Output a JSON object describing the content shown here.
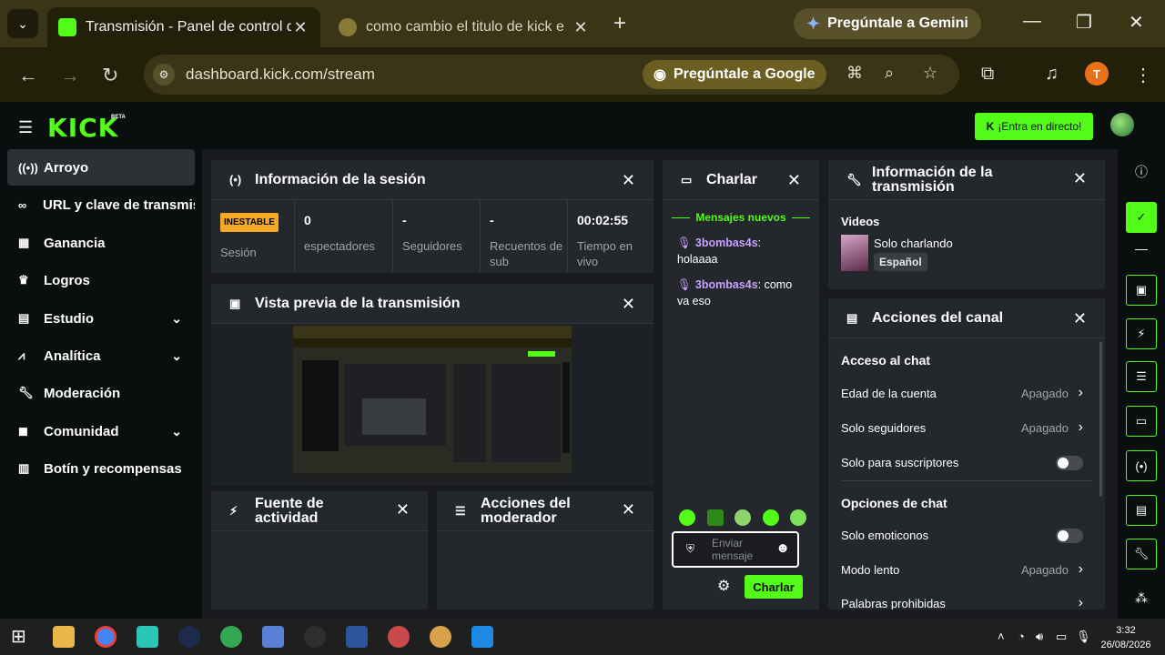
{
  "browser": {
    "tabs": [
      {
        "title": "Transmisión - Panel de control d",
        "active": true
      },
      {
        "title": "como cambio el titulo de kick e",
        "active": false
      }
    ],
    "gemini_label": "Pregúntale a Gemini",
    "url": "dashboard.kick.com/stream",
    "ask_google_label": "Pregúntale a Google",
    "profile_initial": "T",
    "accent": "#53fc18"
  },
  "header": {
    "logo": "KICK",
    "beta": "BETA",
    "golive_label": "¡Entra en directo!"
  },
  "sidebar": {
    "items": [
      {
        "label": "Arroyo",
        "icon": "stream-icon",
        "active": true
      },
      {
        "label": "URL y clave de transmisión",
        "icon": "link-icon"
      },
      {
        "label": "Ganancia",
        "icon": "earnings-icon"
      },
      {
        "label": "Logros",
        "icon": "trophy-icon"
      },
      {
        "label": "Estudio",
        "icon": "studio-icon",
        "expandable": true
      },
      {
        "label": "Analítica",
        "icon": "analytics-icon",
        "expandable": true
      },
      {
        "label": "Moderación",
        "icon": "wrench-icon"
      },
      {
        "label": "Comunidad",
        "icon": "community-icon",
        "expandable": true
      },
      {
        "label": "Botín y recompensas",
        "icon": "rewards-icon"
      }
    ]
  },
  "session": {
    "title": "Información de la sesión",
    "badge": "INESTABLE",
    "stats": [
      {
        "value": "",
        "label": "Sesión"
      },
      {
        "value": "0",
        "label": "espectadores"
      },
      {
        "value": "-",
        "label": "Seguidores"
      },
      {
        "value": "-",
        "label": "Recuentos de sub"
      },
      {
        "value": "00:02:55",
        "label": "Tiempo en vivo"
      }
    ]
  },
  "preview": {
    "title": "Vista previa de la transmisión"
  },
  "activity": {
    "title": "Fuente de actividad"
  },
  "modactions": {
    "title": "Acciones del moderador"
  },
  "chat": {
    "title": "Charlar",
    "new_messages": "Mensajes nuevos",
    "messages": [
      {
        "user": "3bombas4s",
        "text": "holaaaa"
      },
      {
        "user": "3bombas4s",
        "text": "como va eso"
      }
    ],
    "input_placeholder": "Enviar mensaje",
    "send_label": "Charlar"
  },
  "stream_info": {
    "title": "Información de la transmisión",
    "videos_label": "Videos",
    "video_title": "Solo charlando",
    "language": "Español"
  },
  "channel_actions": {
    "title": "Acciones del canal",
    "chat_access": "Acceso al chat",
    "account_age": {
      "label": "Edad de la cuenta",
      "value": "Apagado"
    },
    "followers_only": {
      "label": "Solo seguidores",
      "value": "Apagado"
    },
    "subs_only": {
      "label": "Solo para suscriptores"
    },
    "chat_options": "Opciones de chat",
    "emotes_only": {
      "label": "Solo emoticonos"
    },
    "slow_mode": {
      "label": "Modo lento",
      "value": "Apagado"
    },
    "banned_words": {
      "label": "Palabras prohibidas"
    }
  },
  "taskbar": {
    "time": "3:32",
    "date": "26/08/2026"
  }
}
